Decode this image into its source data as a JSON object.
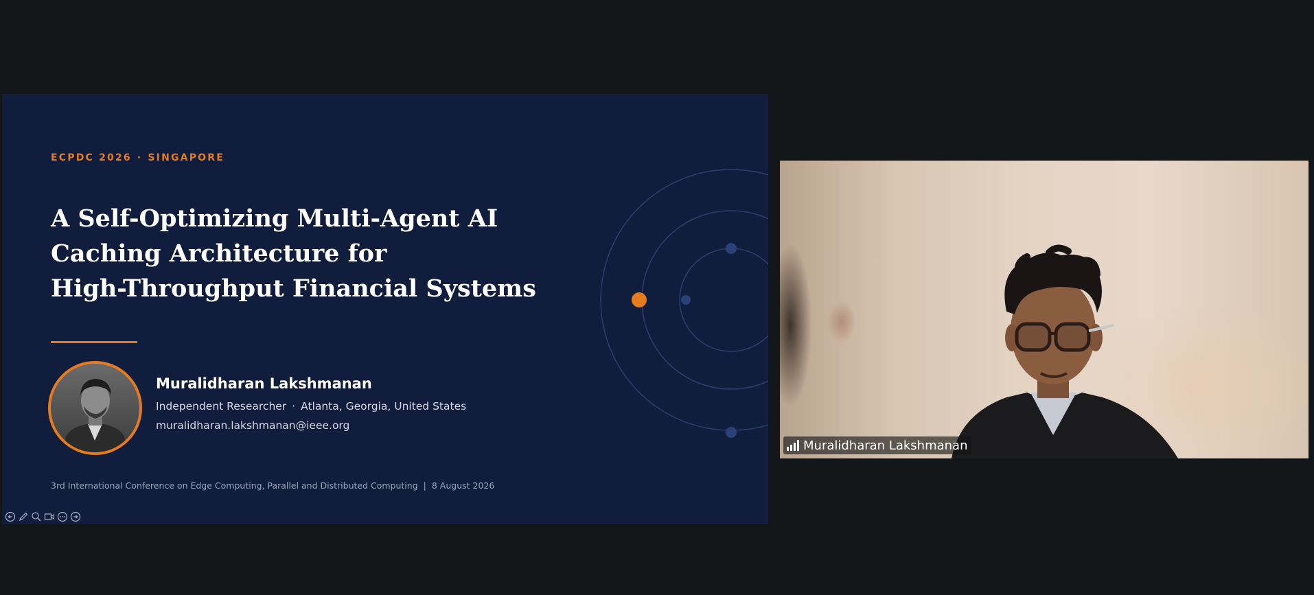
{
  "slide": {
    "kicker_event": "ECPDC 2026",
    "kicker_sep": "·",
    "kicker_location": "SINGAPORE",
    "title_lines": [
      "A Self-Optimizing Multi-Agent AI",
      "Caching Architecture for",
      "High-Throughput Financial Systems"
    ],
    "speaker": {
      "name": "Muralidharan Lakshmanan",
      "role": "Independent Researcher",
      "sep": "·",
      "location": "Atlanta, Georgia, United States",
      "email": "muralidharan.lakshmanan@ieee.org"
    },
    "footer": {
      "conference": "3rd International Conference on Edge Computing, Parallel and Distributed Computing",
      "sep": "|",
      "date": "8 August 2026"
    },
    "colors": {
      "background": "#111d3d",
      "accent": "#e57c1f",
      "orbit": "#2c3f6e"
    },
    "controls": [
      "previous-icon",
      "pen-icon",
      "zoom-icon",
      "video-icon",
      "more-icon",
      "next-icon"
    ]
  },
  "video": {
    "participant_name": "Muralidharan Lakshmanan",
    "signal_icon": "signal-bars-icon"
  }
}
